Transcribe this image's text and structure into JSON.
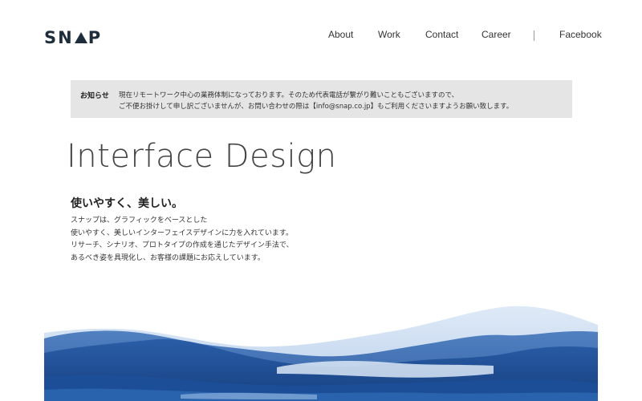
{
  "header": {
    "logo": "SNAP",
    "nav": [
      {
        "label": "About"
      },
      {
        "label": "Work"
      },
      {
        "label": "Contact"
      },
      {
        "label": "Career"
      },
      {
        "label": "Facebook"
      }
    ]
  },
  "notice": {
    "label": "お知らせ",
    "line1": "現在リモートワーク中心の業務体制になっております。そのため代表電話が繋がり難いこともございますので、",
    "line2": "ご不便お掛けして申し訳ございませんが、お問い合わせの際は【info@snap.co.jp】もご利用くださいますようお願い致します。"
  },
  "hero": {
    "title": "Interface Design",
    "catch": "使いやすく、美しい。",
    "description": [
      "スナップは、グラフィックをベースとした",
      "使いやすく、美しいインターフェイスデザインに力を入れています。",
      "リサーチ、シナリオ、プロトタイプの作成を通じたデザイン手法で、",
      "あるべき姿を具現化し、お客様の課題にお応えしています。"
    ]
  },
  "colors": {
    "logo": "#1f2d3a",
    "notice_bg": "#e5e5e5",
    "watercolor_dark": "#1d4f99",
    "watercolor_light": "#8fb6e0"
  }
}
